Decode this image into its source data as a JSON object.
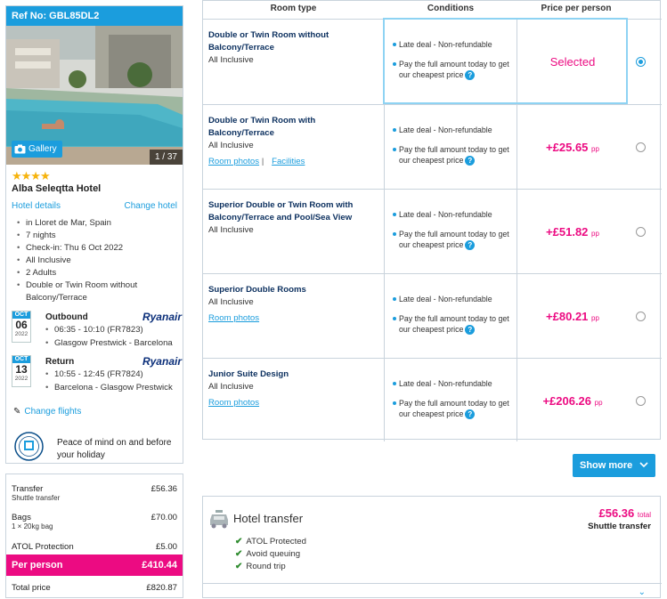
{
  "summary": {
    "ref": "Ref No: GBL85DL2",
    "gallery_label": "Gallery",
    "photo_count": "1 / 37",
    "stars": "★★★★",
    "hotel_name": "Alba Seleqtta Hotel",
    "hotel_details_link": "Hotel details",
    "change_hotel_link": "Change hotel",
    "details": [
      "in Lloret de Mar, Spain",
      "7 nights",
      "Check-in: Thu 6 Oct 2022",
      "All Inclusive",
      "2 Adults",
      "Double or Twin Room without Balcony/Terrace"
    ],
    "outbound": {
      "month": "OCT",
      "day": "06",
      "year": "2022",
      "label": "Outbound",
      "airline": "Ryanair",
      "times": "06:35 - 10:10 (FR7823)",
      "route": "Glasgow Prestwick - Barcelona"
    },
    "return": {
      "month": "OCT",
      "day": "13",
      "year": "2022",
      "label": "Return",
      "airline": "Ryanair",
      "times": "10:55 - 12:45 (FR7824)",
      "route": "Barcelona - Glasgow Prestwick"
    },
    "change_flights_link": "Change flights",
    "peace_text": "Peace of mind on and before your holiday"
  },
  "costs": {
    "transfer_label": "Transfer",
    "transfer_sub": "Shuttle transfer",
    "transfer_value": "£56.36",
    "bags_label": "Bags",
    "bags_sub": "1 × 20kg bag",
    "bags_value": "£70.00",
    "atol_label": "ATOL Protection",
    "atol_value": "£5.00",
    "per_person_label": "Per person",
    "per_person_value": "£410.44",
    "total_label": "Total price",
    "total_value": "£820.87"
  },
  "rooms_table": {
    "headers": [
      "Room type",
      "Conditions",
      "Price per person"
    ],
    "condition_1": "Late deal - Non-refundable",
    "condition_2": "Pay the full amount today to get our cheapest price",
    "pp_suffix": "pp",
    "rooms": [
      {
        "name": "Double or Twin Room without Balcony/Terrace",
        "board": "All Inclusive",
        "price": "Selected",
        "selected": true
      },
      {
        "name": "Double or Twin Room with Balcony/Terrace",
        "board": "All Inclusive",
        "price": "+£25.65",
        "links": [
          "Room photos",
          "Facilities"
        ]
      },
      {
        "name": "Superior Double or Twin Room with Balcony/Terrace and Pool/Sea View",
        "board": "All Inclusive",
        "price": "+£51.82"
      },
      {
        "name": "Superior Double Rooms",
        "board": "All Inclusive",
        "price": "+£80.21",
        "links": [
          "Room photos"
        ]
      },
      {
        "name": "Junior Suite Design",
        "board": "All Inclusive",
        "price": "+£206.26",
        "links": [
          "Room photos"
        ]
      }
    ],
    "show_more": "Show more"
  },
  "transfer": {
    "title": "Hotel transfer",
    "price": "£56.36",
    "price_suffix": "total",
    "type": "Shuttle transfer",
    "features": [
      "ATOL Protected",
      "Avoid queuing",
      "Round trip"
    ]
  },
  "colors": {
    "accent": "#1b9ddd",
    "pink": "#ec0b82",
    "navy": "#0b2f5e",
    "border": "#c9d3dc"
  }
}
